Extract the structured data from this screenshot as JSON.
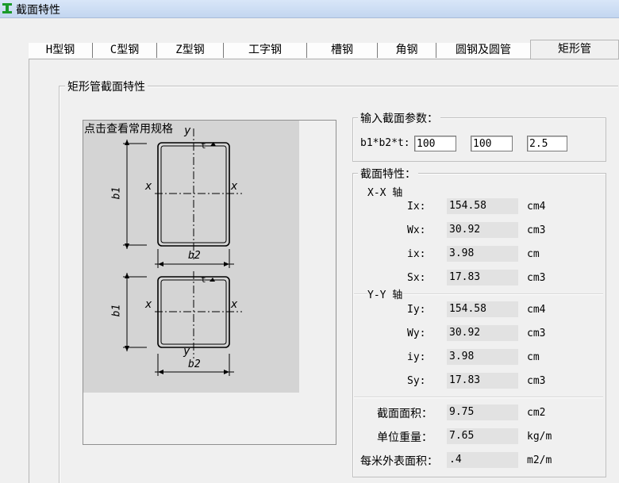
{
  "window": {
    "title": "截面特性"
  },
  "tabs": [
    {
      "label": "H型钢"
    },
    {
      "label": "C型钢"
    },
    {
      "label": "Z型钢"
    },
    {
      "label": "工字钢"
    },
    {
      "label": "槽钢"
    },
    {
      "label": "角钢"
    },
    {
      "label": "圆钢及圆管"
    },
    {
      "label": "矩形管"
    }
  ],
  "active_tab": "矩形管",
  "section_group": {
    "label": "矩形管截面特性"
  },
  "diagram": {
    "spec_link": "点击查看常用规格",
    "labels": {
      "y": "y",
      "x": "x",
      "t": "t",
      "b1": "b1",
      "b2": "b2"
    }
  },
  "input_group": {
    "label": "输入截面参数：",
    "param_label": "b1*b2*t:",
    "b1": "100",
    "b2": "100",
    "t": "2.5"
  },
  "properties": {
    "label": "截面特性：",
    "xx_axis": "X-X 轴",
    "yy_axis": "Y-Y 轴",
    "xx": [
      {
        "name": "Ix:",
        "value": "154.58",
        "unit": "cm4"
      },
      {
        "name": "Wx:",
        "value": "30.92",
        "unit": "cm3"
      },
      {
        "name": "ix:",
        "value": "3.98",
        "unit": "cm"
      },
      {
        "name": "Sx:",
        "value": "17.83",
        "unit": "cm3"
      }
    ],
    "yy": [
      {
        "name": "Iy:",
        "value": "154.58",
        "unit": "cm4"
      },
      {
        "name": "Wy:",
        "value": "30.92",
        "unit": "cm3"
      },
      {
        "name": "iy:",
        "value": "3.98",
        "unit": "cm"
      },
      {
        "name": "Sy:",
        "value": "17.83",
        "unit": "cm3"
      }
    ],
    "general": [
      {
        "name": "截面面积：",
        "value": "9.75",
        "unit": "cm2"
      },
      {
        "name": "单位重量：",
        "value": "7.65",
        "unit": "kg/m"
      },
      {
        "name": "每米外表面积：",
        "value": ".4",
        "unit": "m2/m"
      }
    ]
  }
}
